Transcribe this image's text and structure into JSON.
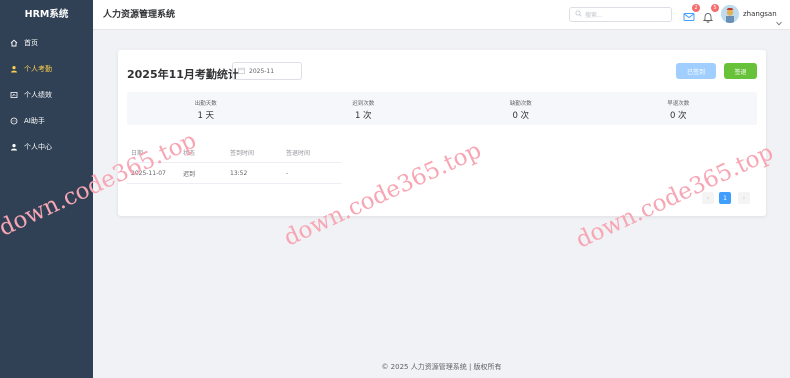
{
  "sidebar": {
    "logo": "HRM系统",
    "items": [
      {
        "label": "首页",
        "icon": "home-icon"
      },
      {
        "label": "个人考勤",
        "icon": "user-icon",
        "active": true
      },
      {
        "label": "个人绩效",
        "icon": "chart-icon"
      },
      {
        "label": "AI助手",
        "icon": "chat-icon"
      },
      {
        "label": "个人中心",
        "icon": "person-icon"
      }
    ]
  },
  "header": {
    "title": "人力资源管理系统",
    "search_placeholder": "搜索...",
    "mail_badge": "2",
    "bell_badge": "5",
    "username": "zhangsan"
  },
  "attendance": {
    "title": "2025年11月考勤统计",
    "month_value": "2025-11",
    "checkin_label": "已签到",
    "checkout_label": "签退",
    "stats": [
      {
        "label": "出勤天数",
        "value": "1 天"
      },
      {
        "label": "迟到次数",
        "value": "1 次"
      },
      {
        "label": "缺勤次数",
        "value": "0 次"
      },
      {
        "label": "早退次数",
        "value": "0 次"
      }
    ],
    "table": {
      "columns": [
        "日期",
        "状态",
        "签到时间",
        "签退时间"
      ],
      "rows": [
        [
          "2025-11-07",
          "迟到",
          "13:52",
          "-"
        ]
      ]
    },
    "pagination": {
      "current": "1",
      "prev": "‹",
      "next": "›"
    }
  },
  "footer": "© 2025 人力资源管理系统 | 版权所有",
  "watermark": "down.code365.top",
  "colors": {
    "sidebar_bg": "#304156",
    "active_menu": "#ffd04b",
    "primary": "#409eff",
    "success": "#67c23a",
    "watermark": "#f7a6b4"
  }
}
